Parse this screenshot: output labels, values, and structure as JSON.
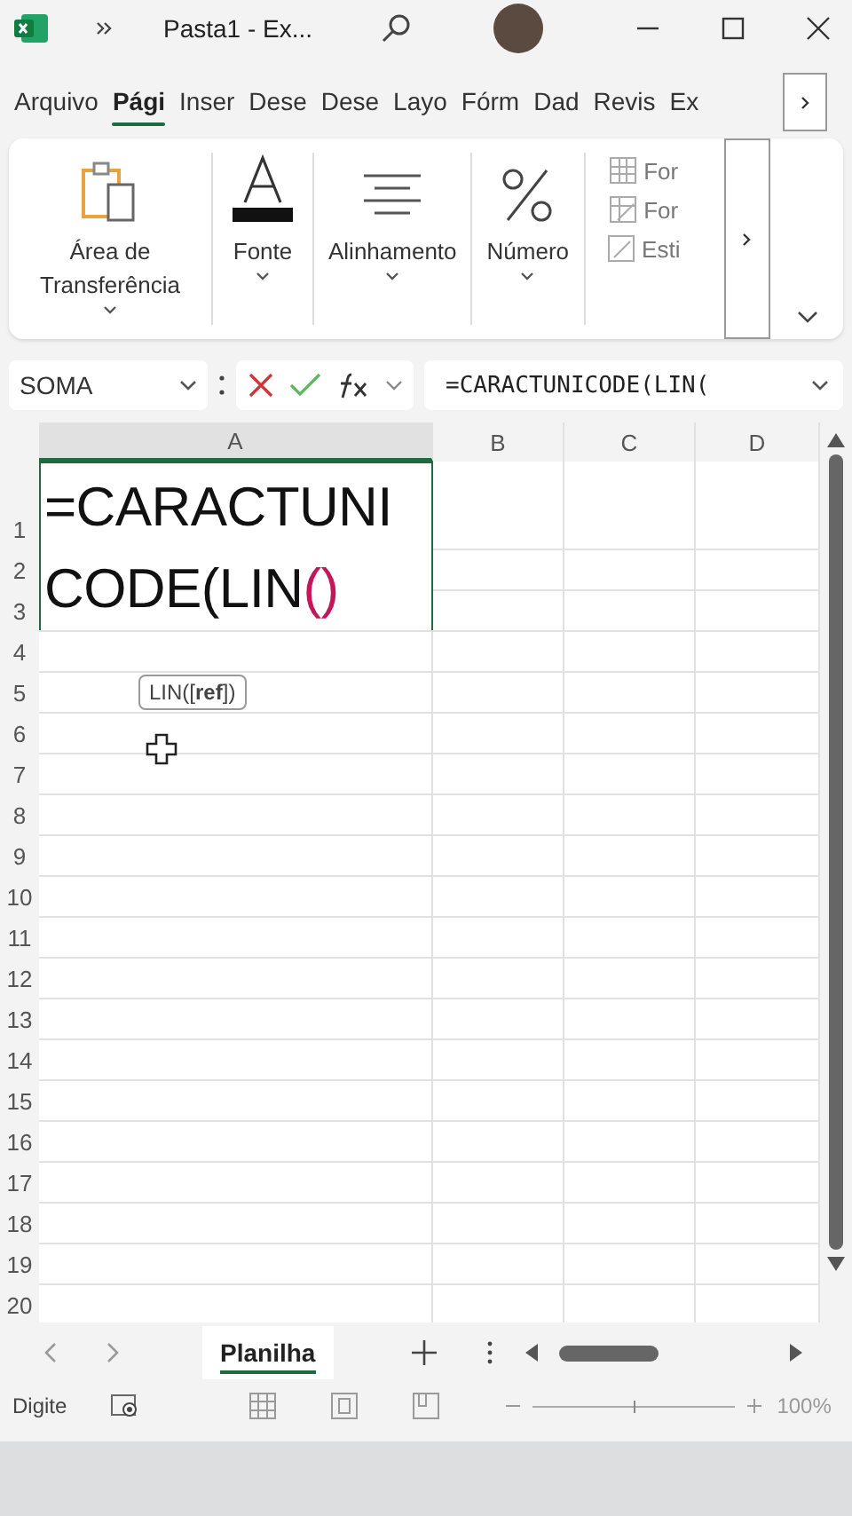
{
  "title_bar": {
    "title": "Pasta1 - Ex..."
  },
  "ribbon_tabs": [
    {
      "label": "Arquivo",
      "selected": false
    },
    {
      "label": "Pági",
      "selected": true
    },
    {
      "label": "Inser",
      "selected": false
    },
    {
      "label": "Dese",
      "selected": false
    },
    {
      "label": "Dese",
      "selected": false
    },
    {
      "label": "Layo",
      "selected": false
    },
    {
      "label": "Fórm",
      "selected": false
    },
    {
      "label": "Dad",
      "selected": false
    },
    {
      "label": "Revis",
      "selected": false
    },
    {
      "label": "Ex",
      "selected": false
    }
  ],
  "ribbon_groups": [
    {
      "kind": "clipboard",
      "label": "Área de Transferência"
    },
    {
      "kind": "font",
      "label": "Fonte"
    },
    {
      "kind": "alignment",
      "label": "Alinhamento"
    },
    {
      "kind": "number",
      "label": "Número"
    },
    {
      "kind": "styles",
      "items": [
        "For",
        "For",
        "Esti"
      ]
    }
  ],
  "formula_bar": {
    "name_box": "SOMA",
    "formula": "=CARACTUNICODE(LIN("
  },
  "columns": [
    "A",
    "B",
    "C",
    "D"
  ],
  "rows": [
    "1",
    "2",
    "3",
    "4",
    "5",
    "6",
    "7",
    "8",
    "9",
    "10",
    "11",
    "12",
    "13",
    "14",
    "15",
    "16",
    "17",
    "18",
    "19",
    "20"
  ],
  "cell_editor": {
    "text": "=CARACTUNICODE(LIN",
    "highlight": "()"
  },
  "tooltip": "LIN([**ref**])",
  "sheet_tabs": [
    {
      "label": "Planilha",
      "selected": true
    }
  ],
  "status_bar": {
    "mode": "Digite",
    "zoom": "100%",
    "zoom_level": {
      "level": 0.5
    }
  }
}
